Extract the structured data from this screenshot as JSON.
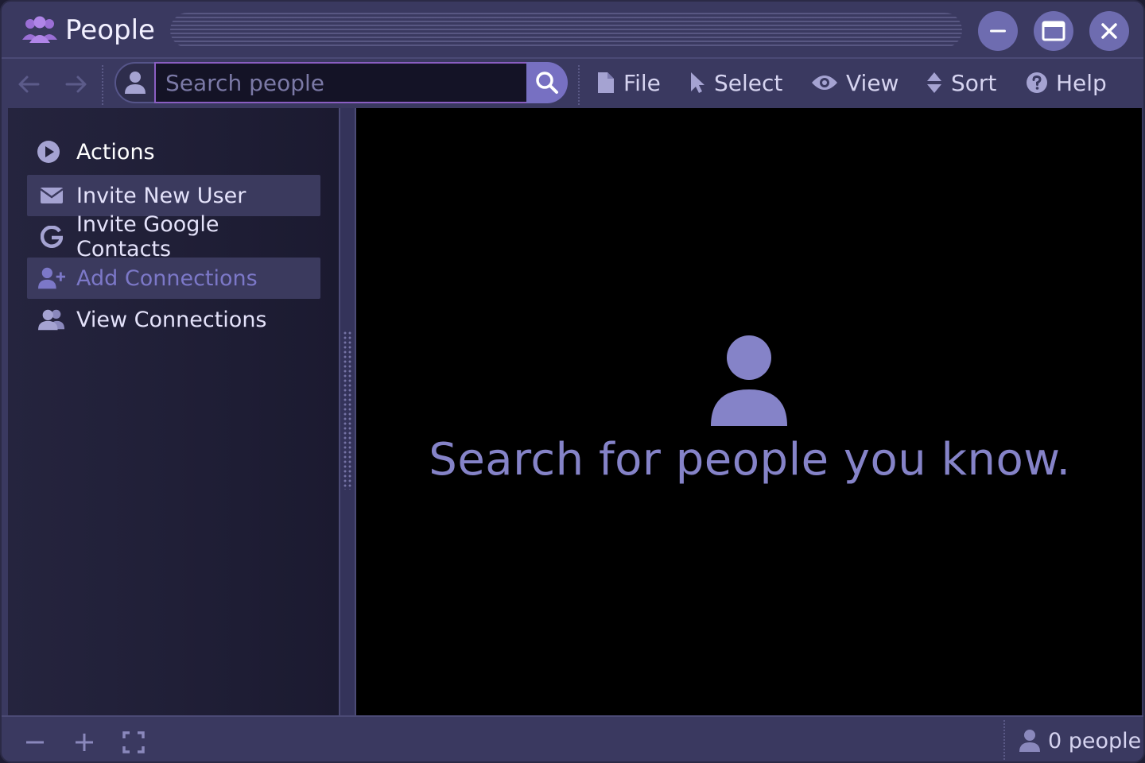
{
  "window": {
    "title": "People",
    "controls": {
      "minimize": "minimize",
      "maximize": "maximize",
      "close": "close"
    }
  },
  "toolbar": {
    "search": {
      "placeholder": "Search people",
      "value": ""
    },
    "menu": [
      {
        "label": "File",
        "icon": "file-icon"
      },
      {
        "label": "Select",
        "icon": "pointer-icon"
      },
      {
        "label": "View",
        "icon": "eye-icon"
      },
      {
        "label": "Sort",
        "icon": "sort-icon"
      },
      {
        "label": "Help",
        "icon": "help-icon"
      }
    ]
  },
  "sidebar": {
    "section_title": "Actions",
    "items": [
      {
        "label": "Invite New User",
        "icon": "envelope-icon",
        "state": "hover"
      },
      {
        "label": "Invite Google Contacts",
        "icon": "google-icon",
        "state": "normal"
      },
      {
        "label": "Add Connections",
        "icon": "user-plus-icon",
        "state": "active"
      },
      {
        "label": "View Connections",
        "icon": "users-icon",
        "state": "normal"
      }
    ]
  },
  "main": {
    "empty_message": "Search for people you know."
  },
  "statusbar": {
    "people_count": "0 people"
  },
  "colors": {
    "chrome": "#3a3960",
    "accent": "#7770c2",
    "focus_border": "#8a5ec2",
    "muted_text": "#8583c8",
    "sidebar_bg": "#1f1e35"
  }
}
